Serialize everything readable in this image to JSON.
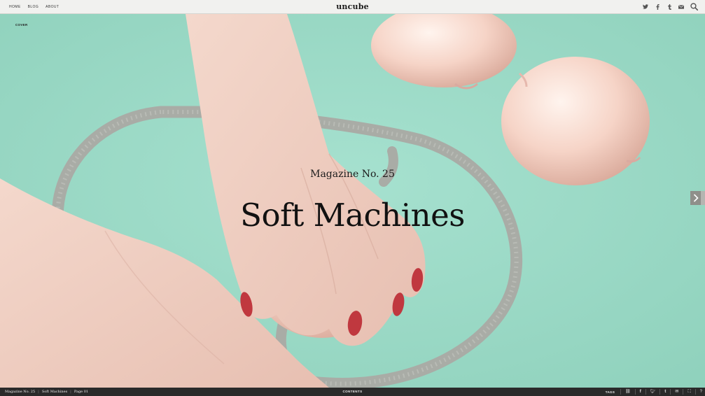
{
  "header": {
    "nav": [
      "HOME",
      "BLOG",
      "ABOUT"
    ],
    "logo": "uncube",
    "icons": [
      "twitter-icon",
      "facebook-icon",
      "tumblr-icon",
      "mail-icon",
      "search-icon"
    ]
  },
  "page": {
    "section_label": "COVER",
    "kicker": "Magazine No. 25",
    "title": "Soft Machines"
  },
  "footer": {
    "crumbs": [
      "Magazine No. 25",
      "Soft Machines",
      "Page 01"
    ],
    "contents": "CONTENTS",
    "tags": "TAGS",
    "icons": [
      "link-icon",
      "facebook-icon",
      "twitter-icon",
      "tumblr-icon",
      "mail-icon",
      "fullscreen-icon",
      "help-icon"
    ]
  },
  "colors": {
    "background": "#9fdcc8",
    "topbar": "#f1f1ef",
    "bottombar": "#2a2a2a",
    "arrow": "#8f8f8a"
  }
}
